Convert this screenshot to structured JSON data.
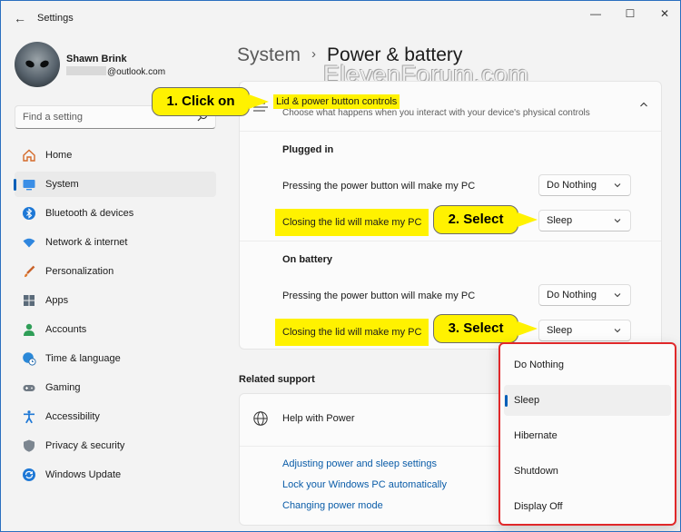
{
  "window": {
    "title": "Settings",
    "controls": {
      "minimize": "—",
      "maximize": "☐",
      "close": "✕"
    }
  },
  "profile": {
    "name": "Shawn Brink",
    "email_suffix": "@outlook.com"
  },
  "search": {
    "placeholder": "Find a setting"
  },
  "nav": {
    "items": [
      {
        "label": "Home",
        "icon": "home-icon"
      },
      {
        "label": "System",
        "icon": "system-icon",
        "active": true
      },
      {
        "label": "Bluetooth & devices",
        "icon": "bluetooth-icon"
      },
      {
        "label": "Network & internet",
        "icon": "wifi-icon"
      },
      {
        "label": "Personalization",
        "icon": "brush-icon"
      },
      {
        "label": "Apps",
        "icon": "apps-icon"
      },
      {
        "label": "Accounts",
        "icon": "accounts-icon"
      },
      {
        "label": "Time & language",
        "icon": "globe-clock-icon"
      },
      {
        "label": "Gaming",
        "icon": "gamepad-icon"
      },
      {
        "label": "Accessibility",
        "icon": "accessibility-icon"
      },
      {
        "label": "Privacy & security",
        "icon": "shield-icon"
      },
      {
        "label": "Windows Update",
        "icon": "update-icon"
      }
    ]
  },
  "header": {
    "parent": "System",
    "separator": "›",
    "current": "Power & battery",
    "watermark": "ElevenForum.com"
  },
  "lid_card": {
    "title": "Lid & power button controls",
    "subtitle": "Choose what happens when you interact with your device's physical controls",
    "plugged_in": {
      "heading": "Plugged in",
      "power_button_label": "Pressing the power button will make my PC",
      "power_button_value": "Do Nothing",
      "lid_label": "Closing the lid will make my PC",
      "lid_value": "Sleep"
    },
    "on_battery": {
      "heading": "On battery",
      "power_button_label": "Pressing the power button will make my PC",
      "power_button_value": "Do Nothing",
      "lid_label": "Closing the lid will make my PC",
      "lid_value": "Sleep"
    }
  },
  "callouts": {
    "step1": "1. Click on",
    "step2": "2. Select",
    "step3": "3. Select"
  },
  "related_support": {
    "title": "Related support",
    "help_item": "Help with Power",
    "links": [
      "Adjusting power and sleep settings",
      "Lock your Windows PC automatically",
      "Changing power mode"
    ]
  },
  "flyout": {
    "options": [
      "Do Nothing",
      "Sleep",
      "Hibernate",
      "Shutdown",
      "Display Off"
    ],
    "selected": "Sleep"
  },
  "colors": {
    "accent": "#005fb8",
    "highlight": "#fff200",
    "flyout_border": "#e0282a",
    "link": "#0a5ca8"
  }
}
